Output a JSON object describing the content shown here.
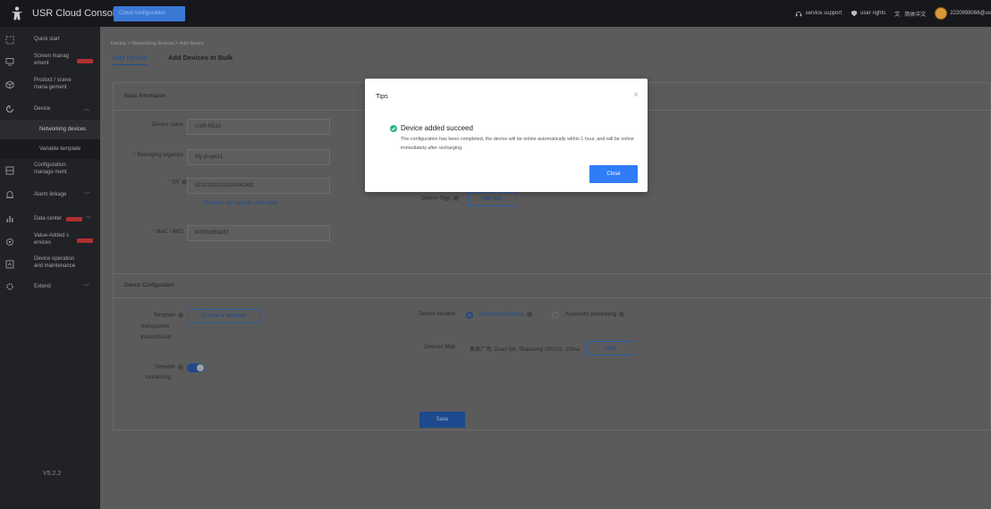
{
  "topbar": {
    "title": "USR Cloud Console",
    "tab": "Cloud configuration",
    "service_support": "service support",
    "user_rights": "user rights",
    "language": "简体中文",
    "user": "2220898066@us"
  },
  "sidebar": {
    "items": [
      {
        "label": "Quick start",
        "icon": "quick-start-icon"
      },
      {
        "label": "Screen manag ement",
        "icon": "monitor-icon"
      },
      {
        "label": "Product / scene mana gement",
        "icon": "cube-icon"
      },
      {
        "label": "Device",
        "icon": "device-icon"
      },
      {
        "label": "Networking devices"
      },
      {
        "label": "Variable template"
      },
      {
        "label": "Configuration manage ment",
        "icon": "config-icon"
      },
      {
        "label": "Alarm linkage",
        "icon": "alarm-icon"
      },
      {
        "label": "Data center",
        "icon": "chart-icon"
      },
      {
        "label": "Value-Added s ervices",
        "icon": "value-added-icon"
      },
      {
        "label": "Device operation and maintenance",
        "icon": "maintenance-icon"
      },
      {
        "label": "Extend",
        "icon": "extend-icon"
      }
    ],
    "version": "V5.2.2"
  },
  "breadcrumb": "Device  >  Networking devices  >  Add device",
  "tabs": {
    "add_device": "Add Device",
    "add_bulk": "Add Devices In Bulk"
  },
  "basic": {
    "title": "Basic Information",
    "device_name_label": "Device name",
    "device_name_value": "USR-N520",
    "org_label": "Belonging organize",
    "org_value": "My project1",
    "sn_label": "SN",
    "sn_value": "02102321101200041881",
    "sn_link": "SN does not support, click here",
    "mac_label": "MAC / IMEI",
    "mac_value": "f4700c863e87",
    "tags_label": "Device Tags",
    "tags_button": "Add tags"
  },
  "config": {
    "title": "Device Configuration",
    "template_label_1": "Template",
    "template_label_2": "/transparent",
    "template_label_3": "transmission",
    "template_button": "Choose a template",
    "network_label_1": "Network",
    "network_label_2": "monitoring",
    "network_monitoring_on": true,
    "location_label": "Device location",
    "manual": "Manual positioning",
    "automatic": "Automatic positioning",
    "map_label": "Devices Map",
    "map_value": "奥体广场, Jinan SN, Shandong 250101, China",
    "map_button": "Map"
  },
  "save": "Save",
  "modal": {
    "title": "Tips",
    "close_symbol": "×",
    "heading": "Device added succeed",
    "message": "The configuration has been completed, the device will be online automatically within 1 hour, and will be online immediately after recharging.",
    "button": "Close"
  },
  "colors": {
    "primary": "#2f7cf6",
    "success": "#2fb57c",
    "sidebar": "#202226",
    "topbar": "#17181c"
  }
}
